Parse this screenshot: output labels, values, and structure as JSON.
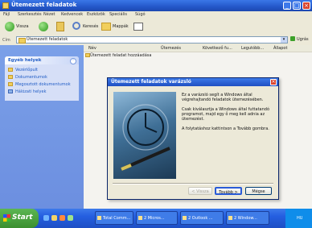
{
  "window": {
    "title": "Ütemezett feladatok",
    "menu": [
      "Fájl",
      "Szerkesztés",
      "Nézet",
      "Kedvencek",
      "Eszközök",
      "Speciális",
      "Súgó"
    ],
    "toolbar": {
      "back": "Vissza",
      "search": "Keresés",
      "folders": "Mappák"
    },
    "address": {
      "label": "Cím",
      "value": "Ütemezett feladatok",
      "go": "Ugrás"
    }
  },
  "sidebar": {
    "panel_title": "Egyéb helyek",
    "items": [
      "Vezérlőpult",
      "Dokumentumok",
      "Megosztott dokumentumok",
      "Hálózati helyek"
    ]
  },
  "content": {
    "columns": [
      "Név",
      "Ütemezés",
      "Következő fu...",
      "Legutóbb...",
      "Állapot"
    ],
    "rows": [
      "Ütemezett feladat hozzáadása"
    ]
  },
  "dialog": {
    "title": "Ütemezett feladatok varázsló",
    "paragraph1": "Ez a varázsló segít a Windows által végrehajtandó feladatok ütemezésében.",
    "paragraph2": "Csak kiválasztja a Windows által futtatandó programot, majd egy ő meg kell adnia az ütemezést.",
    "paragraph3": "A folytatáshoz kattintson a Tovább gombra.",
    "buttons": {
      "back": "< Vissza",
      "next": "Tovább >",
      "cancel": "Mégse"
    }
  },
  "taskbar": {
    "start": "Start",
    "tasks": [
      "Total Comm...",
      "2 Micros...",
      "2 Outlook ...",
      "2 Window..."
    ],
    "tray": "HU"
  }
}
